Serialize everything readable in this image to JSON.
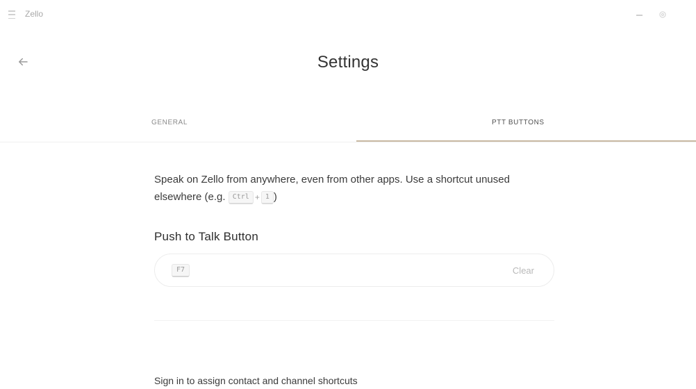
{
  "window": {
    "app_title": "Zello",
    "icons": [
      "menu-icon",
      "minimize-icon",
      "gear-icon"
    ]
  },
  "header": {
    "title": "Settings",
    "back_icon": "arrow-left-icon"
  },
  "tabs": [
    {
      "label": "GENERAL",
      "active": false
    },
    {
      "label": "PTT BUTTONS",
      "active": true
    }
  ],
  "ptt": {
    "intro_text": "Speak on Zello from anywhere, even from other apps. Use a shortcut unused elsewhere (e.g.",
    "example_keys": [
      "Ctrl",
      "1"
    ],
    "example_plus": "+",
    "example_close": ")",
    "section_title": "Push to Talk Button",
    "field_value": "F7",
    "clear_label": "Clear",
    "signin_text": "Sign in to assign contact and channel shortcuts"
  },
  "colors": {
    "tab_indicator": "#c9b9a3",
    "text_primary": "#333333",
    "text_muted": "#8a8a8a"
  }
}
